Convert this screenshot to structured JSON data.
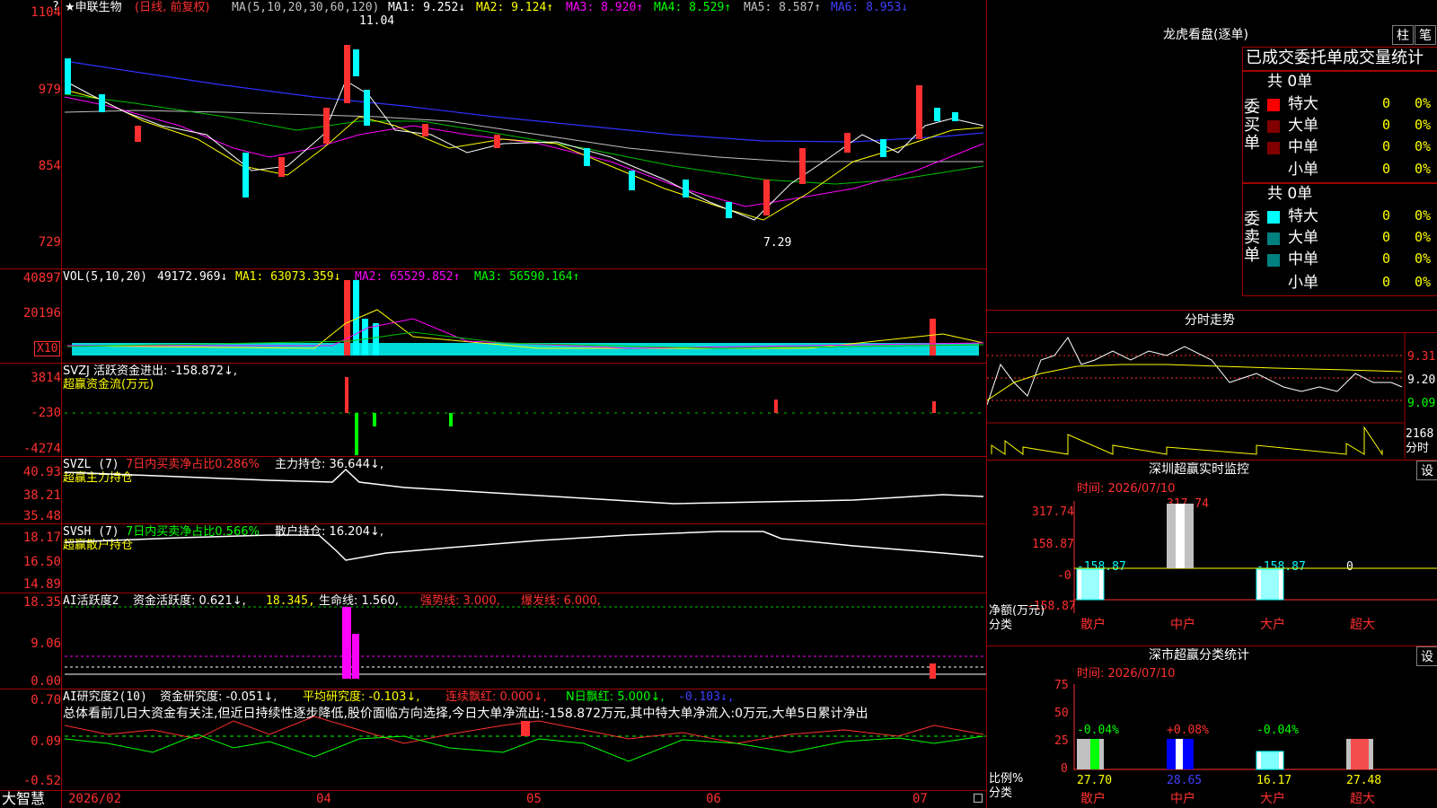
{
  "main": {
    "stock_name": "★申联生物",
    "period": "(日线, 前复权)",
    "ma_label": "MA(5,10,20,30,60,120)",
    "ma1": "MA1: 9.252↓",
    "ma2": "MA2: 9.124↑",
    "ma3": "MA3: 8.920↑",
    "ma4": "MA4: 8.529↑",
    "ma5": "MA5: 8.587↑",
    "ma6": "MA6: 8.953↓",
    "high_mark": "11.04",
    "low_mark": "7.29",
    "y_ticks": [
      "1104",
      "979",
      "854",
      "729"
    ],
    "question_mark": "?"
  },
  "vol": {
    "label": "VOL(5,10,20)",
    "value": "49172.969↓",
    "ma1": "MA1: 63073.359↓",
    "ma2": "MA2: 65529.852↑",
    "ma3": "MA3: 56590.164↑",
    "y_ticks": [
      "40897",
      "20196"
    ],
    "unit": "X10"
  },
  "svzj": {
    "label": "SVZJ  活跃资金进出: -158.872↓,",
    "sub": "超赢资金流(万元)",
    "y_ticks": [
      "3814",
      "-230",
      "-4274"
    ]
  },
  "svzl": {
    "label": "SVZL (7)",
    "ratio": "7日内买卖净占比0.286%",
    "hold": "主力持仓: 36.644↓,",
    "sub": "超赢主力持仓",
    "y_ticks": [
      "40.93",
      "38.21",
      "35.48"
    ]
  },
  "svsh": {
    "label": "SVSH (7)",
    "ratio": "7日内买卖净占比0.566%",
    "hold": "散户持仓: 16.204↓,",
    "sub": "超赢散户持仓",
    "y_ticks": [
      "18.17",
      "16.50",
      "14.89"
    ]
  },
  "ai_active": {
    "label": "AI活跃度2",
    "active": "资金活跃度: 0.621↓,",
    "v2": "18.345,",
    "life": "生命线: 1.560,",
    "strong": "强势线: 3.000,",
    "burst": "爆发线: 6.000,",
    "y_ticks": [
      "18.35",
      "9.06",
      "0.00"
    ]
  },
  "ai_research": {
    "label": "AI研究度2(10)",
    "research": "资金研究度: -0.051↓,",
    "avg": "平均研究度: -0.103↓,",
    "cont": "连续飘红: 0.000↓,",
    "ndays": "N日飘红: 5.000↓,",
    "last": "-0.103↓,",
    "summary": "总体看前几日大资金有关注,但近日持续性逐步降低,股价面临方向选择,今日大单净流出:-158.872万元,其中特大单净流入:0万元,大单5日累计净出",
    "y_ticks": [
      "0.70",
      "0.09",
      "-0.52"
    ]
  },
  "xaxis": {
    "brand": "大智慧",
    "labels": [
      "2026/02",
      "04",
      "05",
      "06",
      "07"
    ]
  },
  "lhb": {
    "title": "龙虎看盘(逐单)",
    "btn1": "柱",
    "btn2": "笔",
    "header": "已成交委托单成交量统计",
    "buy_label": "委买单",
    "sell_label": "委卖单",
    "buy_total": "共 0单",
    "sell_total": "共 0单",
    "rows": [
      "特大",
      "大单",
      "中单",
      "小单"
    ],
    "zero": "0",
    "pct": "0%"
  },
  "fenshi": {
    "title": "分时走势",
    "prices": [
      "9.31",
      "9.20",
      "9.09"
    ],
    "vol": "2168",
    "unit": "分时"
  },
  "sz_monitor": {
    "title": "深圳超赢实时监控",
    "settings": "设",
    "time": "时间: 2026/07/10",
    "y_ticks": [
      "317.74",
      "158.87",
      "-0",
      "-158.87"
    ],
    "values": [
      "-158.87",
      "317.74",
      "-158.87",
      "0"
    ],
    "ylabel": "净额(万元)",
    "xlabel": "分类",
    "cats": [
      "散户",
      "中户",
      "大户",
      "超大"
    ]
  },
  "sz_class": {
    "title": "深市超赢分类统计",
    "settings": "设",
    "time": "时间: 2026/07/10",
    "y_ticks": [
      "75",
      "50",
      "25",
      "0"
    ],
    "deltas": [
      "-0.04%",
      "+0.08%",
      "-0.04%"
    ],
    "values": [
      "27.70",
      "28.65",
      "16.17",
      "27.48"
    ],
    "ylabel": "比例%",
    "xlabel": "分类",
    "cats": [
      "散户",
      "中户",
      "大户",
      "超大"
    ]
  },
  "colors": {
    "up": "#ff3030",
    "down": "#00ffff",
    "grid": "#a00000"
  }
}
